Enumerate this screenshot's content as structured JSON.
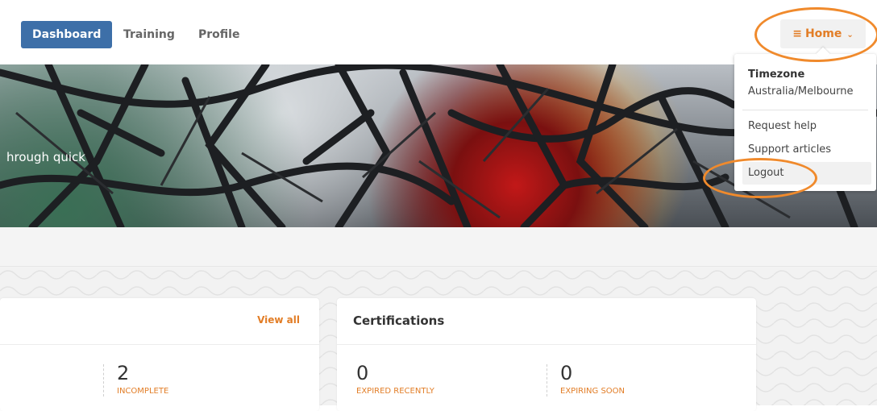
{
  "nav": {
    "items": [
      {
        "label": "Dashboard",
        "active": true
      },
      {
        "label": "Training",
        "active": false
      },
      {
        "label": "Profile",
        "active": false
      }
    ],
    "home_button": {
      "icon": "hamburger-icon",
      "label": "Home",
      "caret": "chevron-down-icon"
    }
  },
  "hero": {
    "text": "hrough quick"
  },
  "dropdown": {
    "timezone_heading": "Timezone",
    "timezone_value": "Australia/Melbourne",
    "items": [
      "Request help",
      "Support articles",
      "Logout"
    ]
  },
  "card_training": {
    "view_all": "View all",
    "stats": [
      {
        "value": "2",
        "label": "INCOMPLETE"
      }
    ]
  },
  "card_certifications": {
    "title": "Certifications",
    "stats": [
      {
        "value": "0",
        "label": "EXPIRED RECENTLY"
      },
      {
        "value": "0",
        "label": "EXPIRING SOON"
      }
    ]
  },
  "colors": {
    "accent": "#e27d26",
    "active_nav": "#3d6fa8",
    "annotation": "#f08a2c"
  }
}
